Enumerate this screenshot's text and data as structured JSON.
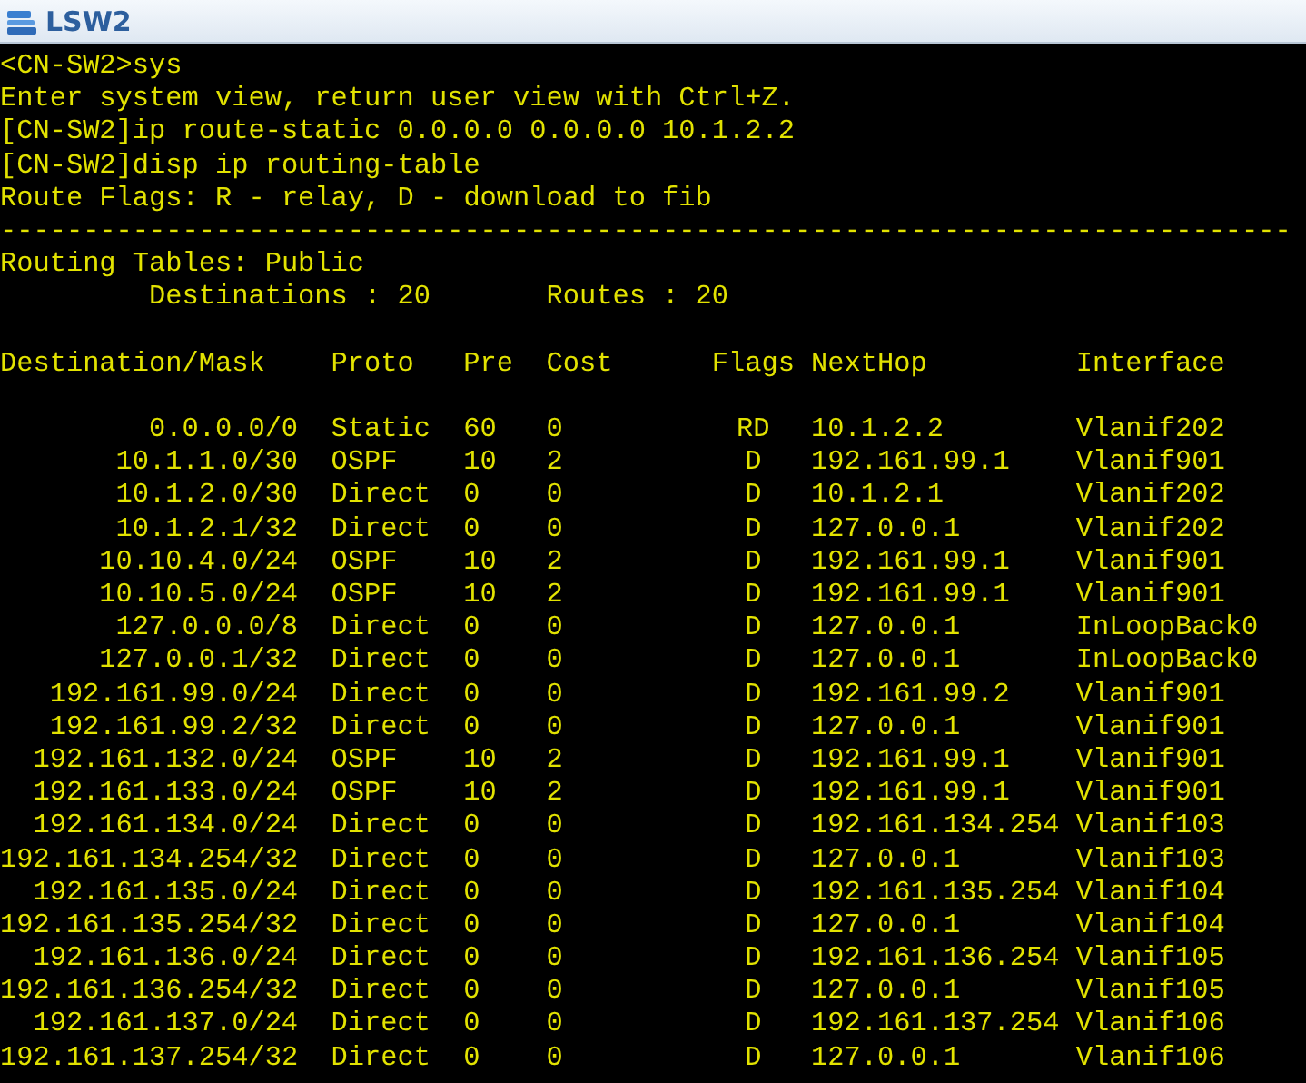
{
  "window": {
    "title": "LSW2"
  },
  "console_lines": [
    "<CN-SW2>sys",
    "Enter system view, return user view with Ctrl+Z.",
    "[CN-SW2]ip route-static 0.0.0.0 0.0.0.0 10.1.2.2",
    "[CN-SW2]disp ip routing-table",
    "Route Flags: R - relay, D - download to fib"
  ],
  "separator": "------------------------------------------------------------------------------",
  "routing_tables": "Routing Tables: Public",
  "destinations": "Destinations : 20",
  "routes_count": "Routes : 20",
  "columns": [
    "Destination/Mask",
    "Proto",
    "Pre",
    "Cost",
    "Flags",
    "NextHop",
    "Interface"
  ],
  "routes": [
    {
      "destination": "0.0.0.0/0",
      "proto": "Static",
      "pre": "60",
      "cost": "0",
      "flags": "RD",
      "nexthop": "10.1.2.2",
      "interface": "Vlanif202"
    },
    {
      "destination": "10.1.1.0/30",
      "proto": "OSPF",
      "pre": "10",
      "cost": "2",
      "flags": "D",
      "nexthop": "192.161.99.1",
      "interface": "Vlanif901"
    },
    {
      "destination": "10.1.2.0/30",
      "proto": "Direct",
      "pre": "0",
      "cost": "0",
      "flags": "D",
      "nexthop": "10.1.2.1",
      "interface": "Vlanif202"
    },
    {
      "destination": "10.1.2.1/32",
      "proto": "Direct",
      "pre": "0",
      "cost": "0",
      "flags": "D",
      "nexthop": "127.0.0.1",
      "interface": "Vlanif202"
    },
    {
      "destination": "10.10.4.0/24",
      "proto": "OSPF",
      "pre": "10",
      "cost": "2",
      "flags": "D",
      "nexthop": "192.161.99.1",
      "interface": "Vlanif901"
    },
    {
      "destination": "10.10.5.0/24",
      "proto": "OSPF",
      "pre": "10",
      "cost": "2",
      "flags": "D",
      "nexthop": "192.161.99.1",
      "interface": "Vlanif901"
    },
    {
      "destination": "127.0.0.0/8",
      "proto": "Direct",
      "pre": "0",
      "cost": "0",
      "flags": "D",
      "nexthop": "127.0.0.1",
      "interface": "InLoopBack0"
    },
    {
      "destination": "127.0.0.1/32",
      "proto": "Direct",
      "pre": "0",
      "cost": "0",
      "flags": "D",
      "nexthop": "127.0.0.1",
      "interface": "InLoopBack0"
    },
    {
      "destination": "192.161.99.0/24",
      "proto": "Direct",
      "pre": "0",
      "cost": "0",
      "flags": "D",
      "nexthop": "192.161.99.2",
      "interface": "Vlanif901"
    },
    {
      "destination": "192.161.99.2/32",
      "proto": "Direct",
      "pre": "0",
      "cost": "0",
      "flags": "D",
      "nexthop": "127.0.0.1",
      "interface": "Vlanif901"
    },
    {
      "destination": "192.161.132.0/24",
      "proto": "OSPF",
      "pre": "10",
      "cost": "2",
      "flags": "D",
      "nexthop": "192.161.99.1",
      "interface": "Vlanif901"
    },
    {
      "destination": "192.161.133.0/24",
      "proto": "OSPF",
      "pre": "10",
      "cost": "2",
      "flags": "D",
      "nexthop": "192.161.99.1",
      "interface": "Vlanif901"
    },
    {
      "destination": "192.161.134.0/24",
      "proto": "Direct",
      "pre": "0",
      "cost": "0",
      "flags": "D",
      "nexthop": "192.161.134.254",
      "interface": "Vlanif103"
    },
    {
      "destination": "192.161.134.254/32",
      "proto": "Direct",
      "pre": "0",
      "cost": "0",
      "flags": "D",
      "nexthop": "127.0.0.1",
      "interface": "Vlanif103"
    },
    {
      "destination": "192.161.135.0/24",
      "proto": "Direct",
      "pre": "0",
      "cost": "0",
      "flags": "D",
      "nexthop": "192.161.135.254",
      "interface": "Vlanif104"
    },
    {
      "destination": "192.161.135.254/32",
      "proto": "Direct",
      "pre": "0",
      "cost": "0",
      "flags": "D",
      "nexthop": "127.0.0.1",
      "interface": "Vlanif104"
    },
    {
      "destination": "192.161.136.0/24",
      "proto": "Direct",
      "pre": "0",
      "cost": "0",
      "flags": "D",
      "nexthop": "192.161.136.254",
      "interface": "Vlanif105"
    },
    {
      "destination": "192.161.136.254/32",
      "proto": "Direct",
      "pre": "0",
      "cost": "0",
      "flags": "D",
      "nexthop": "127.0.0.1",
      "interface": "Vlanif105"
    },
    {
      "destination": "192.161.137.0/24",
      "proto": "Direct",
      "pre": "0",
      "cost": "0",
      "flags": "D",
      "nexthop": "192.161.137.254",
      "interface": "Vlanif106"
    },
    {
      "destination": "192.161.137.254/32",
      "proto": "Direct",
      "pre": "0",
      "cost": "0",
      "flags": "D",
      "nexthop": "127.0.0.1",
      "interface": "Vlanif106"
    }
  ]
}
